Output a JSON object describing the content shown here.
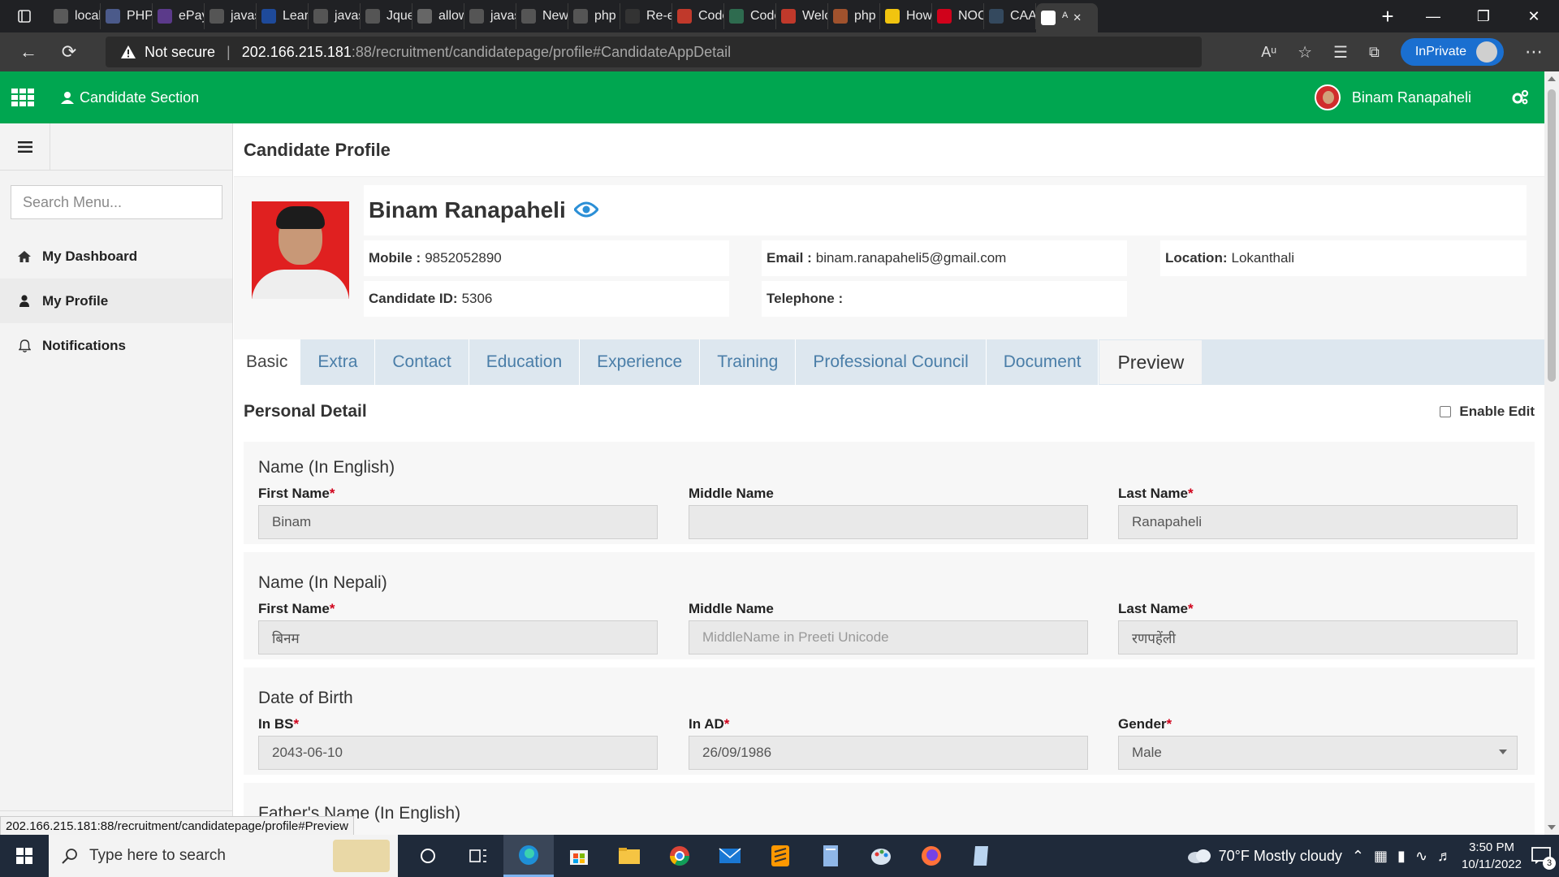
{
  "browser": {
    "tabs": [
      {
        "label": "local",
        "color": "#5a5a5a"
      },
      {
        "label": "PHP:",
        "color": "#4b5a8a"
      },
      {
        "label": "ePay",
        "color": "#5b3a8a"
      },
      {
        "label": "javas",
        "color": "#555555"
      },
      {
        "label": "Learr",
        "color": "#1e4a9a"
      },
      {
        "label": "javas",
        "color": "#555555"
      },
      {
        "label": "Jquer",
        "color": "#555555"
      },
      {
        "label": "allow",
        "color": "#666666"
      },
      {
        "label": "javas",
        "color": "#555555"
      },
      {
        "label": "New",
        "color": "#555555"
      },
      {
        "label": "php",
        "color": "#555555"
      },
      {
        "label": "Re-er",
        "color": "#333333"
      },
      {
        "label": "Code",
        "color": "#c0392b"
      },
      {
        "label": "Code",
        "color": "#2e6b4f"
      },
      {
        "label": "Welc",
        "color": "#c0392b"
      },
      {
        "label": "php",
        "color": "#a0522d"
      },
      {
        "label": "How",
        "color": "#f1c40f"
      },
      {
        "label": "NOC",
        "color": "#d0021b"
      },
      {
        "label": "CAA",
        "color": "#34495e"
      },
      {
        "label": "ᴬ",
        "color": "#ffffff"
      }
    ],
    "not_secure": "Not secure",
    "url_host": "202.166.215.181",
    "url_path": ":88/recruitment/candidatepage/profile#CandidateAppDetail",
    "inprivate": "InPrivate"
  },
  "header": {
    "app_title": "Candidate Section",
    "user_name": "Binam Ranapaheli"
  },
  "sidebar": {
    "search_placeholder": "Search Menu...",
    "items": [
      {
        "label": "My Dashboard",
        "icon": "home-icon"
      },
      {
        "label": "My Profile",
        "icon": "user-icon"
      },
      {
        "label": "Notifications",
        "icon": "bell-icon"
      }
    ]
  },
  "profile": {
    "page_title": "Candidate Profile",
    "name": "Binam Ranapaheli",
    "mobile_label": "Mobile :",
    "mobile": "9852052890",
    "email_label": "Email :",
    "email": "binam.ranapaheli5@gmail.com",
    "location_label": "Location:",
    "location": "Lokanthali",
    "candidate_id_label": "Candidate ID:",
    "candidate_id": "5306",
    "telephone_label": "Telephone :",
    "telephone": ""
  },
  "tabs": [
    "Basic",
    "Extra",
    "Contact",
    "Education",
    "Experience",
    "Training",
    "Professional Council",
    "Document",
    "Preview"
  ],
  "form": {
    "section_title": "Personal Detail",
    "enable_edit": "Enable Edit",
    "name_en_title": "Name (In English)",
    "name_np_title": "Name (In Nepali)",
    "dob_title": "Date of Birth",
    "next_title": "Father's Name (In English)",
    "first_name_label": "First Name",
    "middle_name_label": "Middle Name",
    "last_name_label": "Last Name",
    "first_name_en": "Binam",
    "middle_name_en": "",
    "last_name_en": "Ranapaheli",
    "first_name_np": "बिनम",
    "middle_name_np_placeholder": "MiddleName in Preeti Unicode",
    "last_name_np": "रणपहेंली",
    "in_bs_label": "In BS",
    "in_ad_label": "In AD",
    "gender_label": "Gender",
    "in_bs": "2043-06-10",
    "in_ad": "26/09/1986",
    "gender": "Male"
  },
  "status_url": "202.166.215.181:88/recruitment/candidatepage/profile#Preview",
  "taskbar": {
    "search_placeholder": "Type here to search",
    "weather": "70°F  Mostly cloudy",
    "time": "3:50 PM",
    "date": "10/11/2022",
    "notification_count": "3"
  }
}
